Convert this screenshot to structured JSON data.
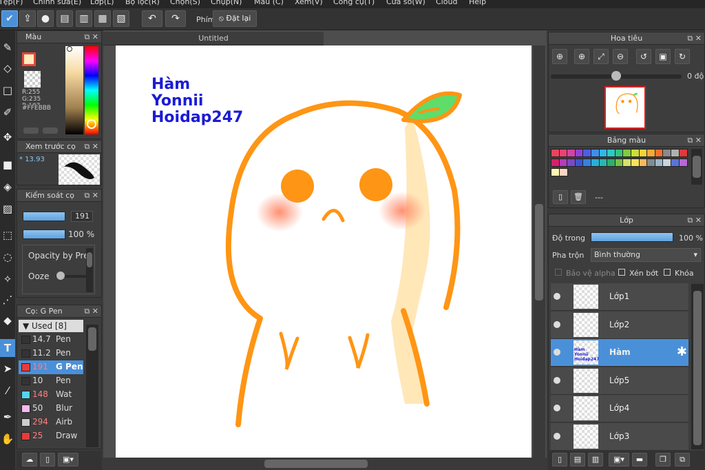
{
  "menu": {
    "items": [
      "Tệp(F)",
      "Chỉnh sửa(E)",
      "Lớp(L)",
      "Bộ lọc(R)",
      "Chọn(S)",
      "Chụp(N)",
      "Màu (C)",
      "Xem(V)",
      "Công cụ(T)",
      "Cửa sổ(W)",
      "Cloud",
      "Help"
    ]
  },
  "toolbar": {
    "shortcut_label": "Phím",
    "reset_label": "Đặt lại"
  },
  "canvas": {
    "tab_title": "Untitled",
    "art_text": [
      "Hàm",
      "Yonnii",
      "Hoidap247"
    ]
  },
  "color_panel": {
    "title": "Màu",
    "r": "R:255",
    "g": "G:235",
    "b": "B:187",
    "hex": "#FFEBBB",
    "main_color": "#FFEBBB",
    "sub_color": "transparent"
  },
  "brush_preview": {
    "title": "Xem trước cọ",
    "size": "13.93"
  },
  "brush_control": {
    "title": "Kiểm soát cọ",
    "size_value": "191",
    "opacity_value": "100 %",
    "opacity_by_pressure": "Opacity by Pre",
    "ooze": "Ooze"
  },
  "brush_list": {
    "title": "Cọ: G Pen",
    "group": "Used [8]",
    "items": [
      {
        "size": "14.7",
        "name": "Pen",
        "color": "#333333",
        "size_color": "#dddddd"
      },
      {
        "size": "11.2",
        "name": "Pen",
        "color": "#333333",
        "size_color": "#dddddd"
      },
      {
        "size": "191",
        "name": "G Pen",
        "color": "#e83a3a",
        "size_color": "#ff8080"
      },
      {
        "size": "10",
        "name": "Pen",
        "color": "#333333",
        "size_color": "#dddddd"
      },
      {
        "size": "148",
        "name": "Wat",
        "color": "#55d4ee",
        "size_color": "#ff8080"
      },
      {
        "size": "50",
        "name": "Blur",
        "color": "#f3b8f0",
        "size_color": "#dddddd"
      },
      {
        "size": "294",
        "name": "Airb",
        "color": "#cccccc",
        "size_color": "#ff8080"
      },
      {
        "size": "25",
        "name": "Draw",
        "color": "#e83a3a",
        "size_color": "#ff8080"
      }
    ]
  },
  "navigator": {
    "title": "Hoa tiêu",
    "angle": "0 độ"
  },
  "palette_panel": {
    "title": "Bảng màu",
    "name": "---",
    "colors": [
      "#e9435f",
      "#e94376",
      "#d541a8",
      "#8e44d6",
      "#4d5fe0",
      "#3f8fe8",
      "#2db8ec",
      "#2ec9c0",
      "#38c37a",
      "#7fcc3c",
      "#cfdc3a",
      "#f4d43a",
      "#f7a83a",
      "#f2702d",
      "#8a8a8a",
      "#b0b0b0",
      "#e23a3a",
      "#d6206a",
      "#b63bbd",
      "#7a49c5",
      "#3d55cf",
      "#3484dc",
      "#2aaed8",
      "#27b8ac",
      "#2fae6a",
      "#78c046",
      "#d8e26b",
      "#fbe25c",
      "#f7b960",
      "#7e8c94",
      "#9db6c8",
      "#c9d4dd",
      "#5a74d6",
      "#b868d6",
      "#fff6b3",
      "#ffd3c2"
    ]
  },
  "layer_panel": {
    "title": "Lớp",
    "opacity_label": "Độ trong",
    "opacity_value": "100 %",
    "blend_label": "Pha trộn",
    "blend_value": "Bình thường",
    "protect_alpha": "Bảo vệ alpha",
    "clipping": "Xén bớt",
    "lock": "Khóa",
    "layers": [
      "Lớp1",
      "Lớp2",
      "Hàm",
      "Lớp5",
      "Lớp4",
      "Lớp3"
    ],
    "selected_index": 2,
    "thumb_text": [
      "Hàm",
      "Yonnii",
      "Hoidap247"
    ]
  },
  "colors": {
    "accent": "#4a90d9",
    "art_orange": "#ff9514",
    "art_blue": "#1b1bd6"
  }
}
